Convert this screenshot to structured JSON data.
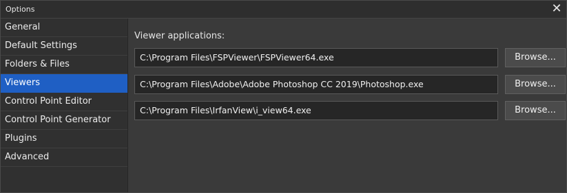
{
  "window": {
    "title": "Options",
    "close_glyph": "✕"
  },
  "sidebar": {
    "items": [
      {
        "label": "General",
        "active": false
      },
      {
        "label": "Default Settings",
        "active": false
      },
      {
        "label": "Folders & Files",
        "active": false
      },
      {
        "label": "Viewers",
        "active": true
      },
      {
        "label": "Control Point Editor",
        "active": false
      },
      {
        "label": "Control Point Generator",
        "active": false
      },
      {
        "label": "Plugins",
        "active": false
      },
      {
        "label": "Advanced",
        "active": false
      }
    ]
  },
  "viewers": {
    "heading": "Viewer applications:",
    "entries": [
      {
        "path": "C:\\Program Files\\FSPViewer\\FSPViewer64.exe",
        "button": "Browse..."
      },
      {
        "path": "C:\\Program Files\\Adobe\\Adobe Photoshop CC 2019\\Photoshop.exe",
        "button": "Browse..."
      },
      {
        "path": "C:\\Program Files\\IrfanView\\i_view64.exe",
        "button": "Browse..."
      }
    ]
  },
  "colors": {
    "accent": "#1f5fc4",
    "background": "#3a3a3a",
    "sidebar": "#303030"
  }
}
